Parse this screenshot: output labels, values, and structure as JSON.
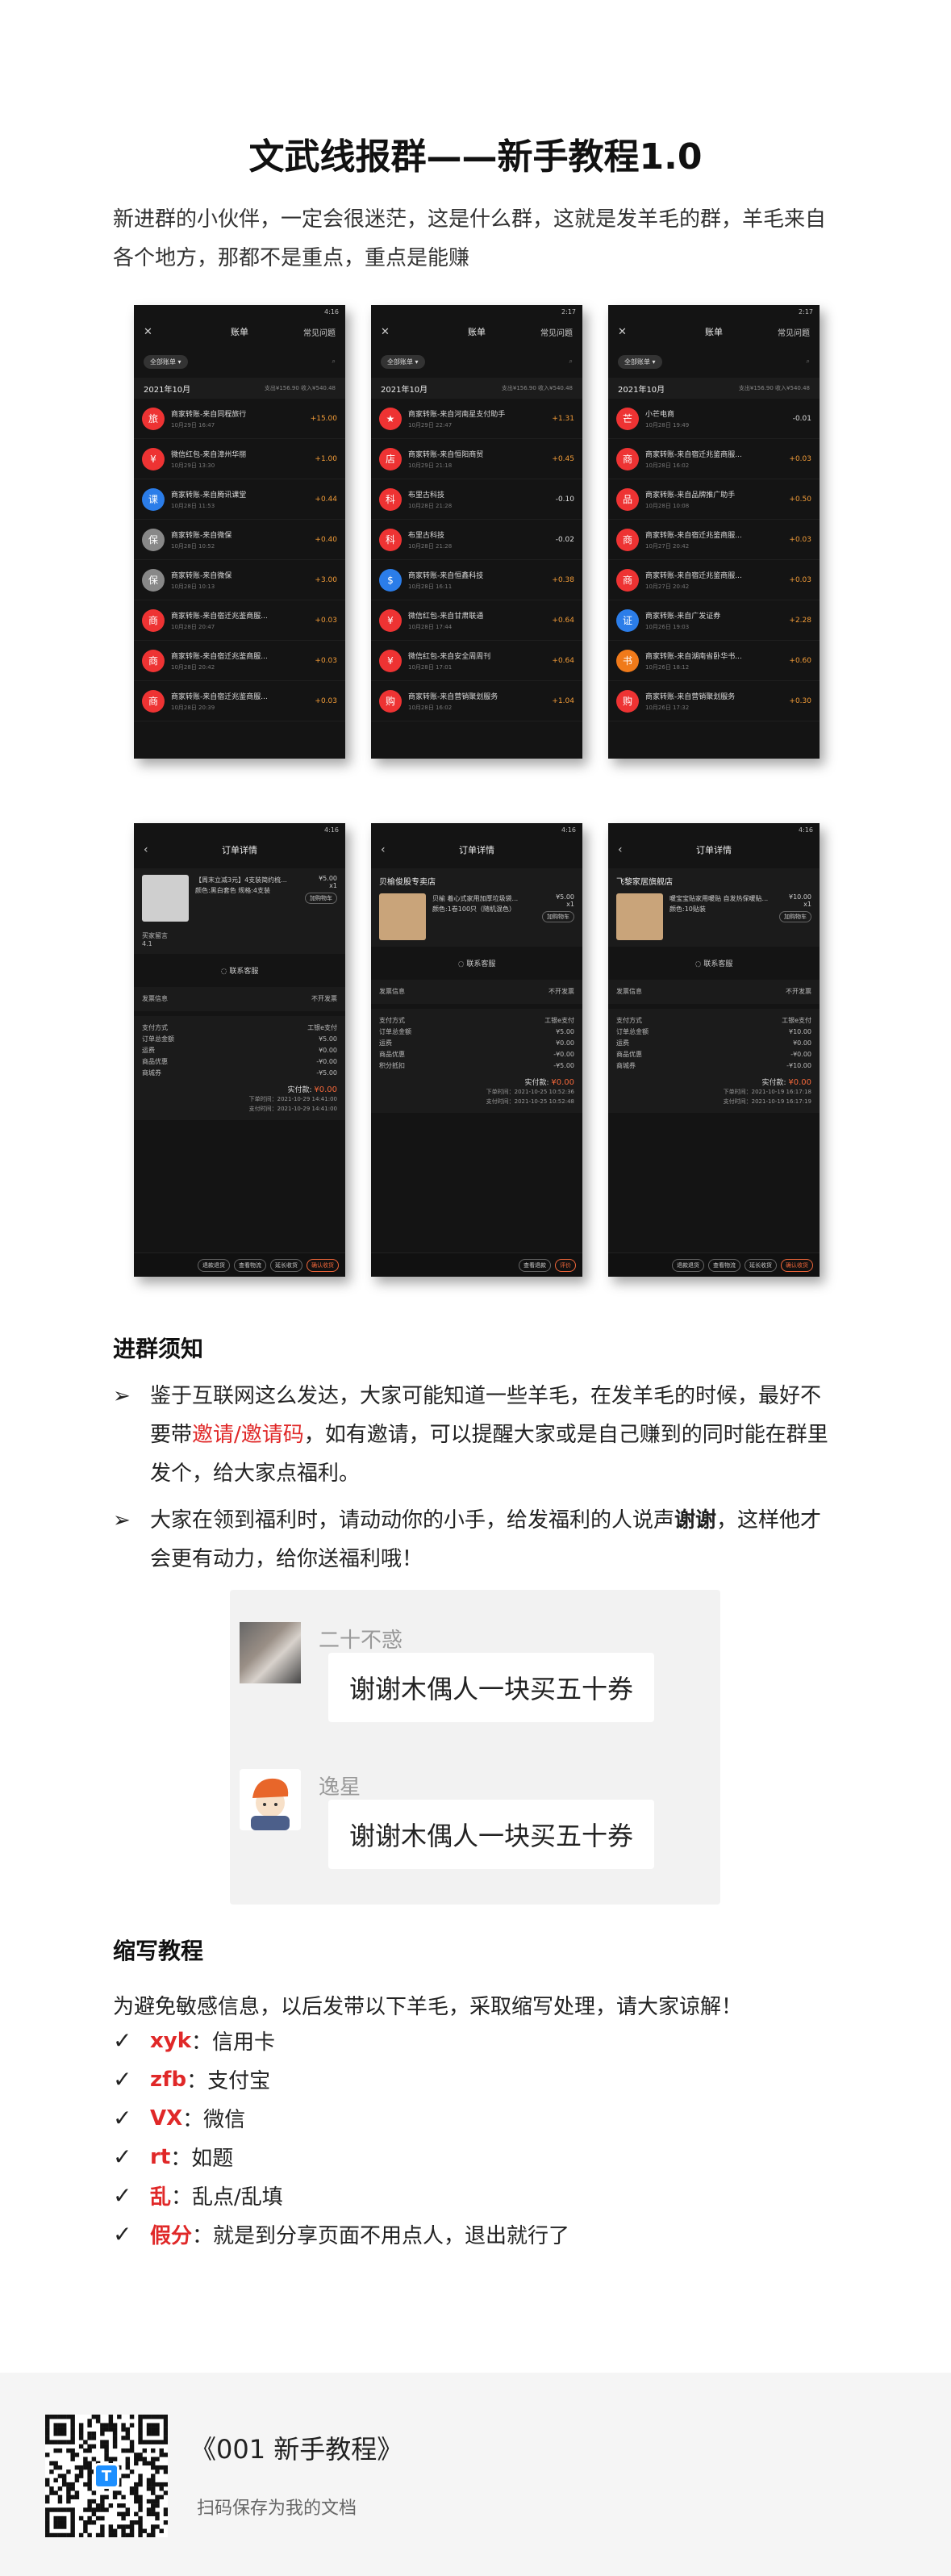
{
  "title": "文武线报群——新手教程1.0",
  "intro": "新进群的小伙伴，一定会很迷茫，这是什么群，这就是发羊毛的群，羊毛来自各个地方，那都不是重点，重点是能赚",
  "bill_screens": [
    {
      "time": "4:16",
      "nav_title": "账单",
      "nav_right": "常见问题",
      "filter": "全部账单",
      "month": "2021年10月",
      "month_stat": "支出¥156.90 收入¥540.48",
      "items": [
        {
          "name": "商家转账-来自同程旅行",
          "time": "10月29日 16:47",
          "amount": "+15.00",
          "icon": "travel-icon"
        },
        {
          "name": "微信红包-来自漳州华丽",
          "time": "10月29日 13:30",
          "amount": "+1.00",
          "icon": "red-packet-icon"
        },
        {
          "name": "商家转账-来自腾讯课堂",
          "time": "10月28日 11:53",
          "amount": "+0.44",
          "icon": "classroom-icon"
        },
        {
          "name": "商家转账-来自微保",
          "time": "10月28日 10:52",
          "amount": "+0.40",
          "icon": "insurance-icon"
        },
        {
          "name": "商家转账-来自微保",
          "time": "10月28日 10:13",
          "amount": "+3.00",
          "icon": "insurance-icon"
        },
        {
          "name": "商家转账-来自宿迁兆鉴商服...",
          "time": "10月28日 20:47",
          "amount": "+0.03",
          "icon": "merchant-icon"
        },
        {
          "name": "商家转账-来自宿迁兆鉴商服...",
          "time": "10月28日 20:42",
          "amount": "+0.03",
          "icon": "merchant-icon"
        },
        {
          "name": "商家转账-来自宿迁兆鉴商服...",
          "time": "10月28日 20:39",
          "amount": "+0.03",
          "icon": "merchant-icon"
        }
      ]
    },
    {
      "time": "2:17",
      "nav_title": "账单",
      "nav_right": "常见问题",
      "filter": "全部账单",
      "month": "2021年10月",
      "month_stat": "支出¥156.90 收入¥540.48",
      "items": [
        {
          "name": "商家转账-来自河南星支付助手",
          "time": "10月29日 22:47",
          "amount": "+1.31",
          "icon": "star-icon"
        },
        {
          "name": "商家转账-来自恒阳商贸",
          "time": "10月29日 21:18",
          "amount": "+0.45",
          "icon": "store-icon"
        },
        {
          "name": "布里古科技",
          "time": "10月28日 21:28",
          "amount": "-0.10",
          "icon": "tech-icon"
        },
        {
          "name": "布里古科技",
          "time": "10月28日 21:28",
          "amount": "-0.02",
          "icon": "tech-icon"
        },
        {
          "name": "商家转账-来自恒鑫科技",
          "time": "10月28日 16:11",
          "amount": "+0.38",
          "icon": "finance-icon"
        },
        {
          "name": "微信红包-来自甘肃联通",
          "time": "10月28日 17:44",
          "amount": "+0.64",
          "icon": "red-packet-icon"
        },
        {
          "name": "微信红包-来自安全周周刊",
          "time": "10月28日 17:01",
          "amount": "+0.64",
          "icon": "red-packet-icon"
        },
        {
          "name": "商家转账-来自营销聚划服务",
          "time": "10月28日 16:02",
          "amount": "+1.04",
          "icon": "shop-icon"
        }
      ]
    },
    {
      "time": "2:17",
      "nav_title": "账单",
      "nav_right": "常见问题",
      "filter": "全部账单",
      "month": "2021年10月",
      "month_stat": "支出¥156.90 收入¥540.48",
      "items": [
        {
          "name": "小芒电商",
          "time": "10月28日 19:49",
          "amount": "-0.01",
          "icon": "mango-icon"
        },
        {
          "name": "商家转账-来自宿迁兆鉴商服...",
          "time": "10月28日 16:02",
          "amount": "+0.03",
          "icon": "merchant-icon"
        },
        {
          "name": "商家转账-来自品牌推广助手",
          "time": "10月28日 10:08",
          "amount": "+0.50",
          "icon": "brand-icon"
        },
        {
          "name": "商家转账-来自宿迁兆鉴商服...",
          "time": "10月27日 20:42",
          "amount": "+0.03",
          "icon": "merchant-icon"
        },
        {
          "name": "商家转账-来自宿迁兆鉴商服...",
          "time": "10月27日 20:42",
          "amount": "+0.03",
          "icon": "merchant-icon"
        },
        {
          "name": "商家转账-来自广发证券",
          "time": "10月26日 19:03",
          "amount": "+2.28",
          "icon": "securities-icon"
        },
        {
          "name": "商家转账-来自湖南省卧华书...",
          "time": "10月26日 18:12",
          "amount": "+0.60",
          "icon": "book-icon"
        },
        {
          "name": "商家转账-来自营销聚划服务",
          "time": "10月26日 17:32",
          "amount": "+0.30",
          "icon": "shop-icon"
        }
      ]
    }
  ],
  "order_screens": [
    {
      "time": "4:16",
      "nav_title": "订单详情",
      "shop": "",
      "goods_title": "【周末立减3元】4支装简约梳...",
      "goods_spec": "颜色:黑白套色 规格:4支装",
      "goods_price": "¥5.00",
      "goods_qty": "x1",
      "goods_btn": "加购物车",
      "extra_label": "买家留言",
      "extra_value": "4.1",
      "contact": "联系客服",
      "invoice_label": "发票信息",
      "invoice_value": "不开发票",
      "rows": [
        [
          "支付方式",
          "工银e支付"
        ],
        [
          "订单总金额",
          "¥5.00"
        ],
        [
          "运费",
          "¥0.00"
        ],
        [
          "商品优惠",
          "-¥0.00"
        ],
        [
          "商城券",
          "-¥5.00"
        ]
      ],
      "paid_label": "实付款:",
      "paid_value": "¥0.00",
      "times": [
        "下单时间：2021-10-29 14:41:00",
        "支付时间：2021-10-29 14:41:00"
      ],
      "buttons": [
        "退款退货",
        "查看物流",
        "延长收货",
        "确认收货"
      ]
    },
    {
      "time": "4:16",
      "nav_title": "订单详情",
      "shop": "贝榆俊股专卖店",
      "goods_title": "贝榆 着心式家用加厚垃圾袋...",
      "goods_spec": "颜色:1卷100只（随机混色）",
      "goods_price": "¥5.00",
      "goods_qty": "x1",
      "goods_btn": "加购物车",
      "extra_label": "",
      "extra_value": "",
      "contact": "联系客服",
      "invoice_label": "发票信息",
      "invoice_value": "不开发票",
      "rows": [
        [
          "支付方式",
          "工银e支付"
        ],
        [
          "订单总金额",
          "¥5.00"
        ],
        [
          "运费",
          "¥0.00"
        ],
        [
          "商品优惠",
          "-¥0.00"
        ],
        [
          "积分抵扣",
          "-¥5.00"
        ]
      ],
      "paid_label": "实付款:",
      "paid_value": "¥0.00",
      "times": [
        "下单时间：2021-10-25 10:52:36",
        "支付时间：2021-10-25 10:52:48"
      ],
      "buttons": [
        "查看退款",
        "评价"
      ]
    },
    {
      "time": "4:16",
      "nav_title": "订单详情",
      "shop": "飞黎家居旗舰店",
      "goods_title": "暖宝宝贴家用暖贴 自发热保暖贴...",
      "goods_spec": "颜色:10贴装",
      "goods_price": "¥10.00",
      "goods_qty": "x1",
      "goods_btn": "加购物车",
      "extra_label": "",
      "extra_value": "",
      "contact": "联系客服",
      "invoice_label": "发票信息",
      "invoice_value": "不开发票",
      "rows": [
        [
          "支付方式",
          "工银e支付"
        ],
        [
          "订单总金额",
          "¥10.00"
        ],
        [
          "运费",
          "¥0.00"
        ],
        [
          "商品优惠",
          "-¥0.00"
        ],
        [
          "商城券",
          "-¥10.00"
        ]
      ],
      "paid_label": "实付款:",
      "paid_value": "¥0.00",
      "times": [
        "下单时间：2021-10-19 16:17:18",
        "支付时间：2021-10-19 16:17:19"
      ],
      "buttons": [
        "退款退货",
        "查看物流",
        "延长收货",
        "确认收货"
      ]
    }
  ],
  "rules_heading": "进群须知",
  "rule1": {
    "p1": "鉴于互联网这么发达，大家可能知道一些羊毛，在发羊毛的时候，最好不要带",
    "red": "邀请/邀请码",
    "p2": "，如有邀请，可以提醒大家或是自己赚到的同时能在群里发个，给大家点福利。"
  },
  "rule2": {
    "p1": "大家在领到福利时，请动动你的小手，给发福利的人说声",
    "bold": "谢谢",
    "p2": "，这样他才会更有动力，给你送福利哦！"
  },
  "chat": [
    {
      "name": "二十不惑",
      "message": "谢谢木偶人一块买五十券"
    },
    {
      "name": "逸星",
      "message": "谢谢木偶人一块买五十券"
    }
  ],
  "abbr_heading": "缩写教程",
  "abbr_intro": "为避免敏感信息，以后发带以下羊毛，采取缩写处理，请大家谅解！",
  "abbreviations": [
    {
      "key": "xyk",
      "value": "：信用卡"
    },
    {
      "key": "zfb",
      "value": "：支付宝"
    },
    {
      "key": "VX",
      "value": "：微信"
    },
    {
      "key": "rt",
      "value": "：如题"
    },
    {
      "key": "乱",
      "value": "：乱点/乱填"
    },
    {
      "key": "假分",
      "value": "：就是到分享页面不用点人，退出就行了"
    }
  ],
  "footer": {
    "doc_title": "《001 新手教程》",
    "doc_sub": "扫码保存为我的文档"
  },
  "colors": {
    "accent_red": "#e02828",
    "amount_orange": "#f29c38",
    "footer_bg": "#f5f5f5"
  }
}
